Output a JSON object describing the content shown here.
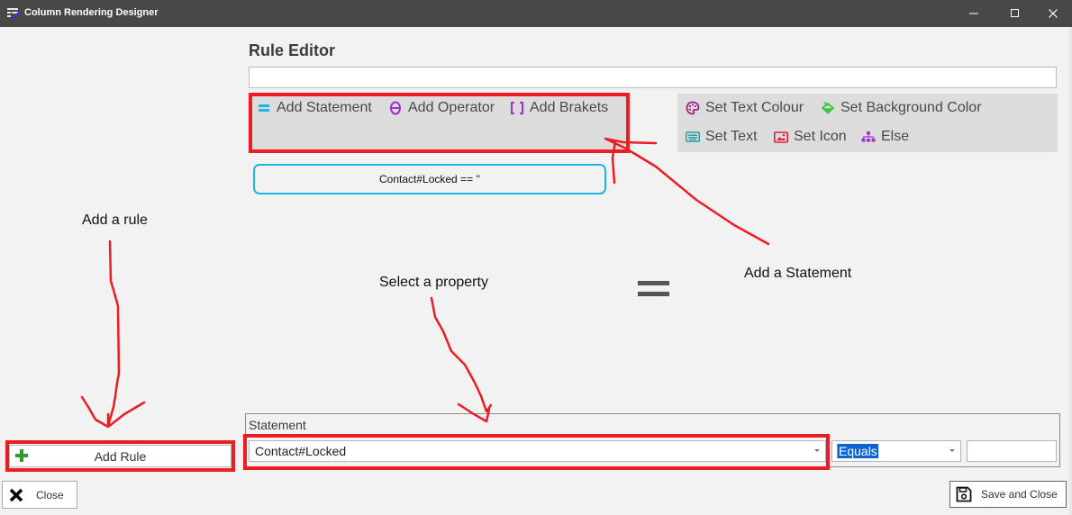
{
  "window": {
    "title": "Column Rendering Designer",
    "controls": [
      "minimize",
      "maximize",
      "close"
    ]
  },
  "rule_editor": {
    "heading": "Rule Editor",
    "rule_name_value": "",
    "statement_tools": [
      {
        "label": "Add Statement",
        "icon": "equals-icon",
        "color": "#1eb4ea"
      },
      {
        "label": "Add Operator",
        "icon": "theta-icon",
        "color": "#9b30d9"
      },
      {
        "label": "Add Brakets",
        "icon": "brackets-icon",
        "color": "#9b30d9"
      }
    ],
    "action_tools": [
      {
        "label": "Set Text Colour",
        "icon": "palette-icon",
        "color": "#a0208a"
      },
      {
        "label": "Set Background Color",
        "icon": "paint-bucket-icon",
        "color": "#3cc43c"
      },
      {
        "label": "Set Text",
        "icon": "keyboard-icon",
        "color": "#2a9d9d"
      },
      {
        "label": "Set Icon",
        "icon": "image-icon",
        "color": "#e0203a"
      },
      {
        "label": "Else",
        "icon": "sitemap-icon",
        "color": "#9b30d9"
      }
    ],
    "statement_chip": "Contact#Locked == ''"
  },
  "annotations": {
    "add_rule": "Add a rule",
    "select_property": "Select a property",
    "add_statement": "Add a Statement",
    "highlight_color": "#ec1c24"
  },
  "statement_panel": {
    "label": "Statement",
    "property_value": "Contact#Locked",
    "operator_value": "Equals",
    "compare_value": ""
  },
  "buttons": {
    "add_rule": "Add Rule",
    "close": "Close",
    "save_and_close": "Save and Close"
  }
}
